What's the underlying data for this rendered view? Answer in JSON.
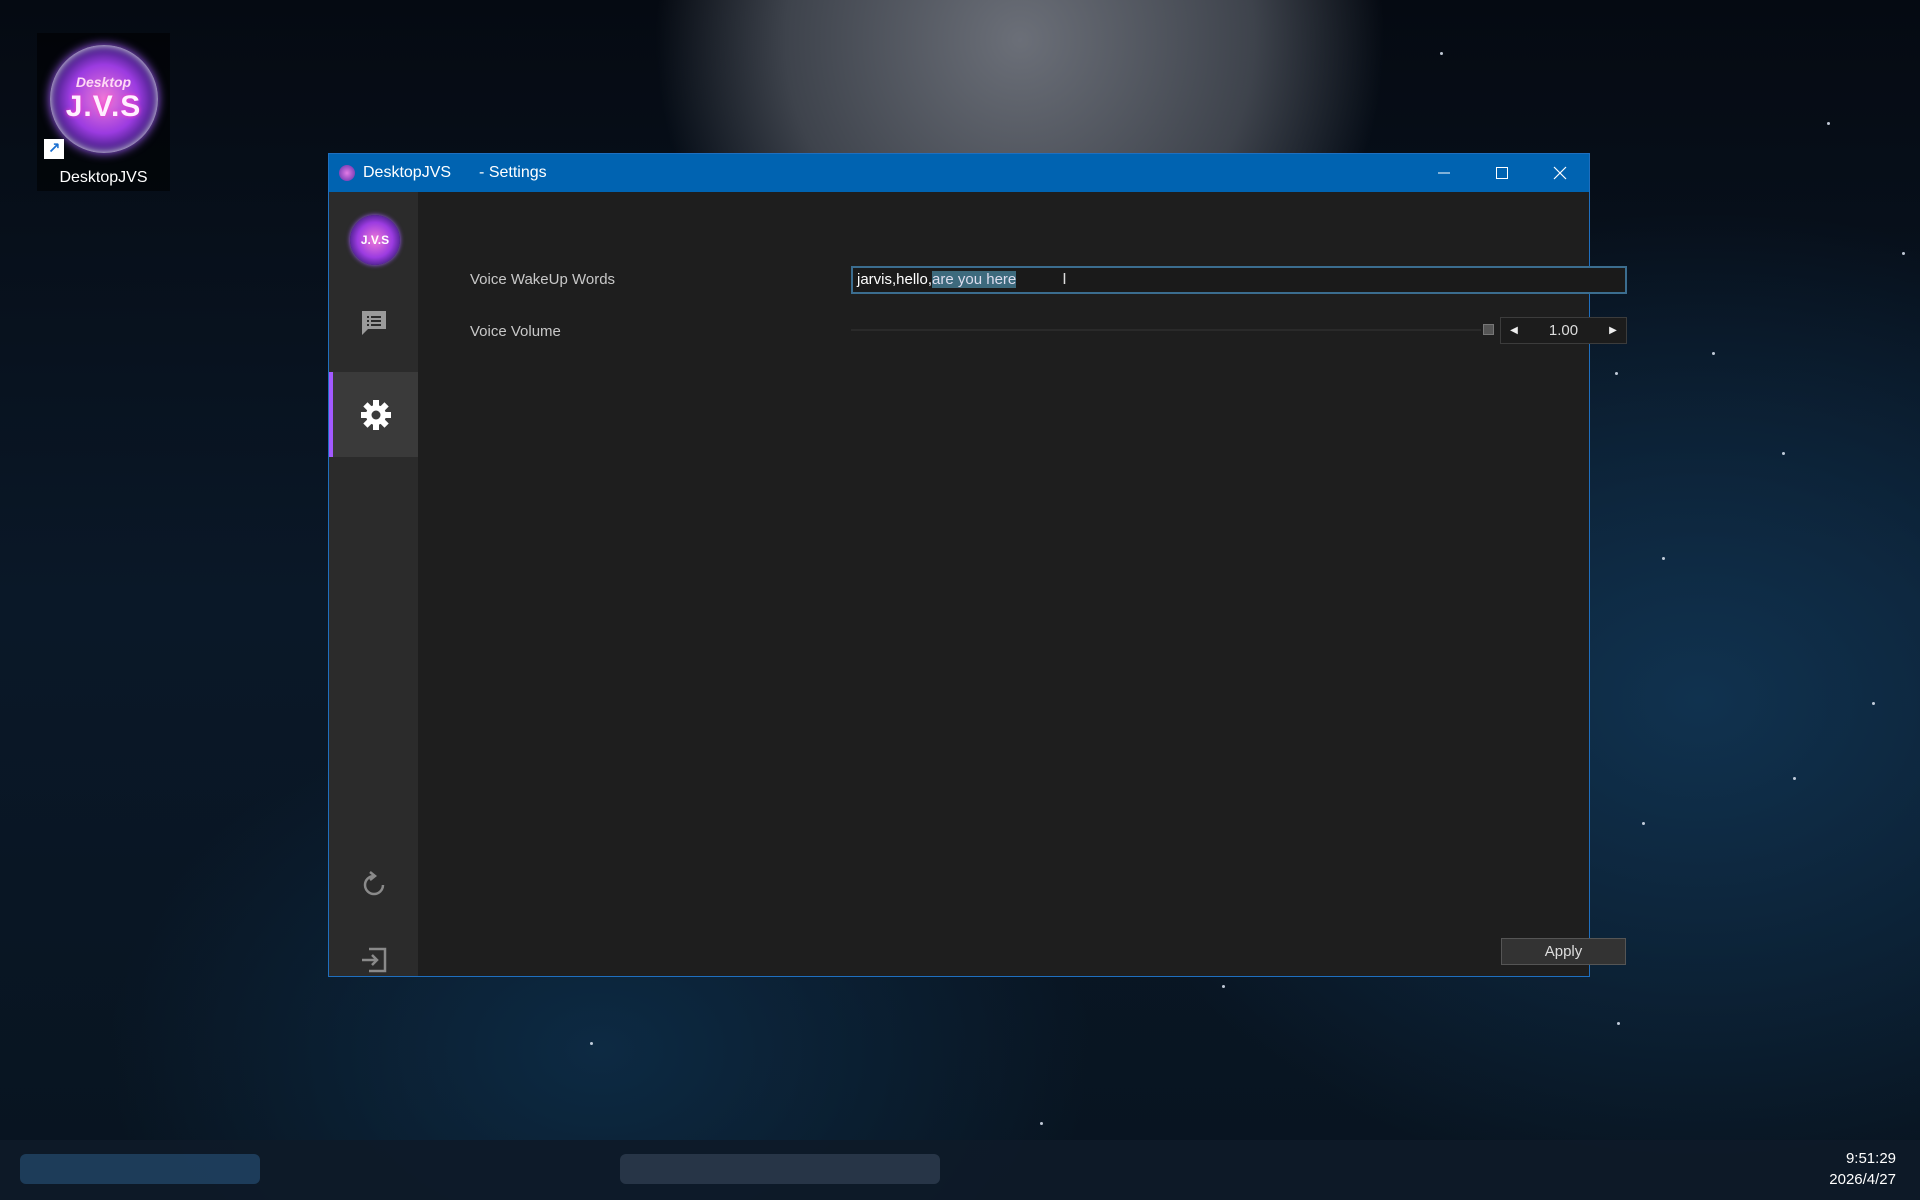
{
  "desktop": {
    "icon_label": "DesktopJVS",
    "logo_line1": "Desktop",
    "logo_line2": "J.V.S"
  },
  "window": {
    "app_name": "DesktopJVS",
    "title_suffix": "- Settings",
    "sidebar_logo_text": "J.V.S",
    "sidebar": {
      "items": [
        {
          "icon": "chat-icon"
        },
        {
          "icon": "gear-icon",
          "active": true
        }
      ],
      "bottom": [
        {
          "icon": "refresh-icon"
        },
        {
          "icon": "exit-icon"
        }
      ]
    }
  },
  "settings": {
    "wakeup_label": "Voice WakeUp Words",
    "wakeup_value_plain": "jarvis,hello,",
    "wakeup_value_selected": "are you here",
    "volume_label": "Voice Volume",
    "volume_value": "1.00",
    "apply_label": "Apply"
  },
  "taskbar": {
    "time": "9:51:29",
    "date": "2026/4/27"
  },
  "colors": {
    "titlebar": "#0063b1",
    "accent": "#a259ff",
    "window_bg": "#1e1e1e",
    "sidebar_bg": "#2b2b2b"
  }
}
